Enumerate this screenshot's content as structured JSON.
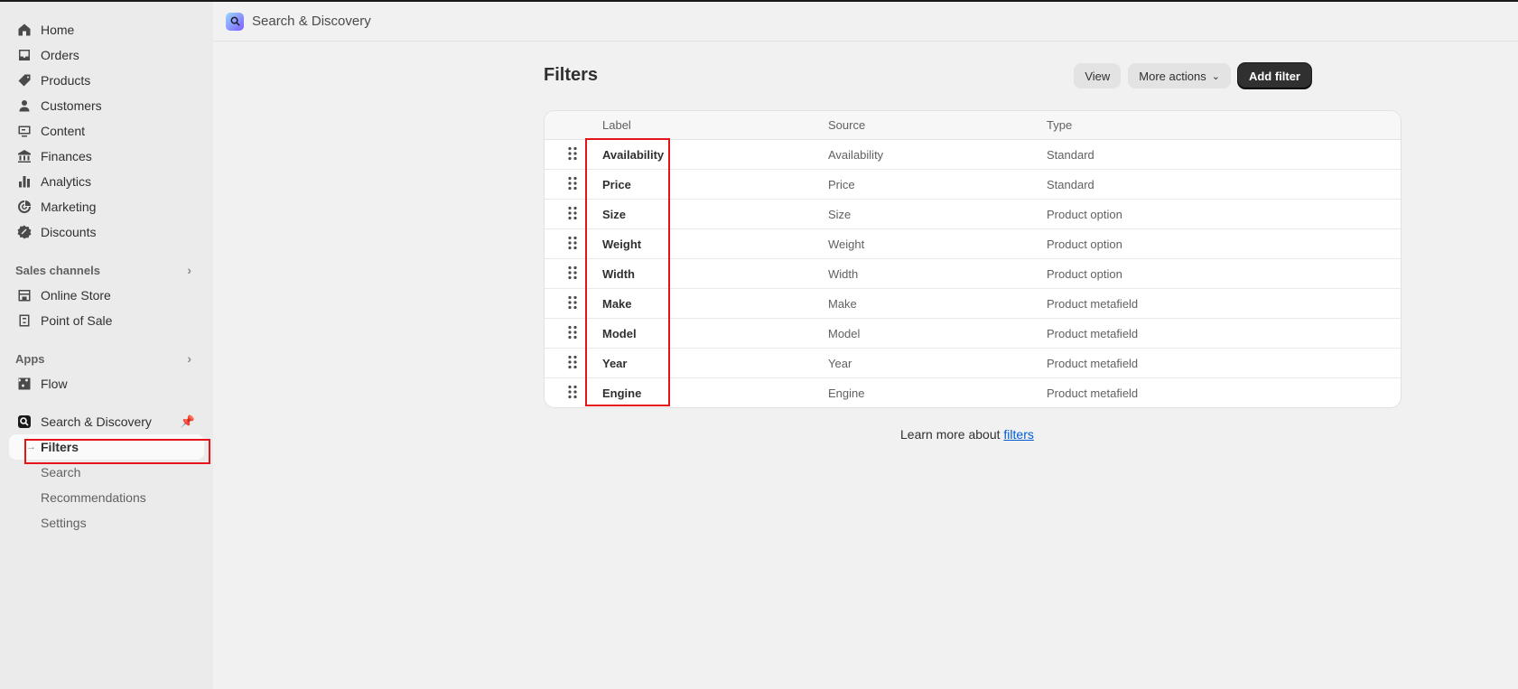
{
  "sidebar": {
    "main_items": [
      {
        "label": "Home",
        "icon": "home-icon"
      },
      {
        "label": "Orders",
        "icon": "inbox-icon"
      },
      {
        "label": "Products",
        "icon": "tag-icon"
      },
      {
        "label": "Customers",
        "icon": "person-icon"
      },
      {
        "label": "Content",
        "icon": "content-icon"
      },
      {
        "label": "Finances",
        "icon": "bank-icon"
      },
      {
        "label": "Analytics",
        "icon": "bar-chart-icon"
      },
      {
        "label": "Marketing",
        "icon": "target-icon"
      },
      {
        "label": "Discounts",
        "icon": "discount-icon"
      }
    ],
    "sales_channels": {
      "label": "Sales channels",
      "items": [
        {
          "label": "Online Store",
          "icon": "store-icon"
        },
        {
          "label": "Point of Sale",
          "icon": "pos-icon"
        }
      ]
    },
    "apps": {
      "label": "Apps",
      "items": [
        {
          "label": "Flow",
          "icon": "flow-icon"
        }
      ]
    },
    "pinned_app": {
      "label": "Search & Discovery",
      "icon": "search-discovery-icon",
      "sub_items": [
        {
          "label": "Filters",
          "active": true
        },
        {
          "label": "Search",
          "active": false
        },
        {
          "label": "Recommendations",
          "active": false
        },
        {
          "label": "Settings",
          "active": false
        }
      ]
    }
  },
  "topbar": {
    "title": "Search & Discovery"
  },
  "page": {
    "title": "Filters",
    "actions": {
      "view": "View",
      "more": "More actions",
      "add": "Add filter"
    },
    "table": {
      "headers": {
        "label": "Label",
        "source": "Source",
        "type": "Type"
      },
      "rows": [
        {
          "label": "Availability",
          "source": "Availability",
          "type": "Standard"
        },
        {
          "label": "Price",
          "source": "Price",
          "type": "Standard"
        },
        {
          "label": "Size",
          "source": "Size",
          "type": "Product option"
        },
        {
          "label": "Weight",
          "source": "Weight",
          "type": "Product option"
        },
        {
          "label": "Width",
          "source": "Width",
          "type": "Product option"
        },
        {
          "label": "Make",
          "source": "Make",
          "type": "Product metafield"
        },
        {
          "label": "Model",
          "source": "Model",
          "type": "Product metafield"
        },
        {
          "label": "Year",
          "source": "Year",
          "type": "Product metafield"
        },
        {
          "label": "Engine",
          "source": "Engine",
          "type": "Product metafield"
        }
      ]
    },
    "learn_more": {
      "prefix": "Learn more about ",
      "link": "filters"
    }
  },
  "colors": {
    "highlight": "#e5141b",
    "primary_button": "#303030",
    "link": "#005bd3"
  }
}
